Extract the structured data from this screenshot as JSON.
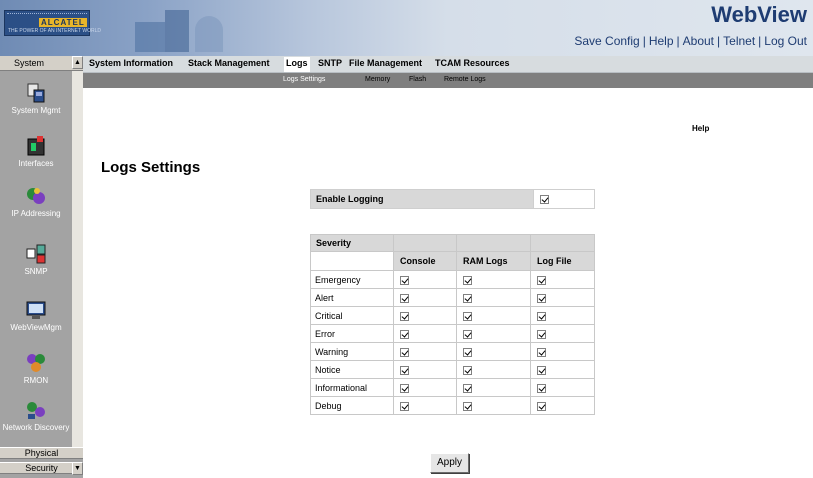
{
  "header": {
    "app_title": "WebView",
    "logo_brand": "ALCATEL",
    "logo_tagline": "THE POWER OF AN INTERNET WORLD",
    "links": [
      "Save Config",
      "Help",
      "About",
      "Telnet",
      "Log Out"
    ]
  },
  "sidebar": {
    "header": "System",
    "items": [
      {
        "label": "System Mgmt",
        "icon": "system-mgmt-icon"
      },
      {
        "label": "Interfaces",
        "icon": "interfaces-icon"
      },
      {
        "label": "IP Addressing",
        "icon": "ip-addressing-icon"
      },
      {
        "label": "SNMP",
        "icon": "snmp-icon"
      },
      {
        "label": "WebViewMgm",
        "icon": "webview-mgmt-icon"
      },
      {
        "label": "RMON",
        "icon": "rmon-icon"
      },
      {
        "label": "Network Discovery",
        "icon": "network-discovery-icon"
      }
    ],
    "physical": "Physical",
    "security": "Security"
  },
  "tabs": [
    "System Information",
    "Stack Management",
    "Logs",
    "SNTP",
    "File Management",
    "TCAM Resources"
  ],
  "active_tab": "Logs",
  "subtabs": [
    "Logs Settings",
    "Memory",
    "Flash",
    "Remote Logs"
  ],
  "active_subtab": "Logs Settings",
  "main": {
    "help": "Help",
    "title": "Logs Settings",
    "enable_logging_label": "Enable Logging",
    "enable_logging_checked": true,
    "severity_header": "Severity",
    "columns": [
      "Console",
      "RAM Logs",
      "Log File"
    ],
    "rows": [
      {
        "name": "Emergency",
        "console": true,
        "ram": true,
        "file": true
      },
      {
        "name": "Alert",
        "console": true,
        "ram": true,
        "file": true
      },
      {
        "name": "Critical",
        "console": true,
        "ram": true,
        "file": true
      },
      {
        "name": "Error",
        "console": true,
        "ram": true,
        "file": true
      },
      {
        "name": "Warning",
        "console": true,
        "ram": true,
        "file": true
      },
      {
        "name": "Notice",
        "console": true,
        "ram": true,
        "file": true
      },
      {
        "name": "Informational",
        "console": true,
        "ram": true,
        "file": true
      },
      {
        "name": "Debug",
        "console": true,
        "ram": true,
        "file": true
      }
    ],
    "apply": "Apply"
  },
  "colors": {
    "header_blue": "#1e3c72",
    "sidebar_gray": "#a3a3a3",
    "tab_bar": "#d7dcdf",
    "subtab_bar": "#7f7f7f",
    "table_header": "#d8d8d8"
  }
}
